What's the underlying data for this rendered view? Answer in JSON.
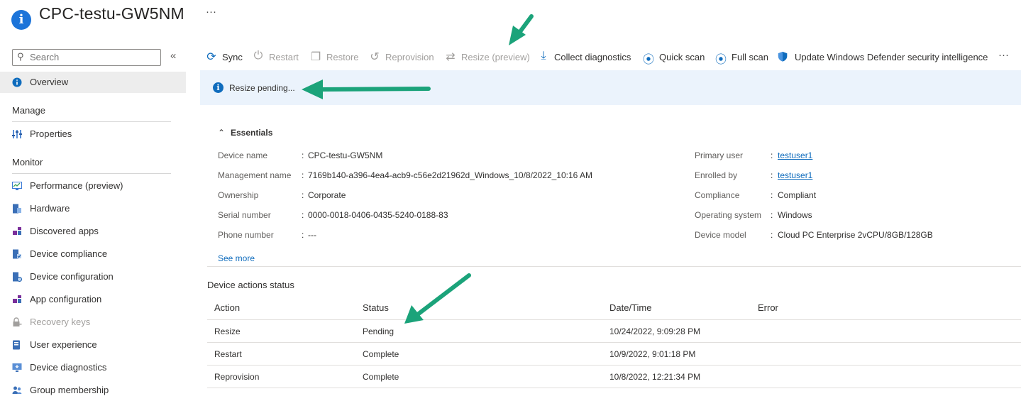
{
  "header": {
    "title": "CPC-testu-GW5NM",
    "more_label": "···"
  },
  "sidebar": {
    "search_placeholder": "Search",
    "collapse_label": "«",
    "overview": "Overview",
    "sections": [
      {
        "title": "Manage",
        "items": [
          {
            "label": "Properties",
            "icon": "properties-icon"
          }
        ]
      },
      {
        "title": "Monitor",
        "items": [
          {
            "label": "Performance (preview)",
            "icon": "performance-icon"
          },
          {
            "label": "Hardware",
            "icon": "hardware-icon"
          },
          {
            "label": "Discovered apps",
            "icon": "apps-icon"
          },
          {
            "label": "Device compliance",
            "icon": "compliance-icon"
          },
          {
            "label": "Device configuration",
            "icon": "configuration-icon"
          },
          {
            "label": "App configuration",
            "icon": "app-config-icon"
          },
          {
            "label": "Recovery keys",
            "icon": "lock-icon",
            "disabled": true
          },
          {
            "label": "User experience",
            "icon": "user-experience-icon"
          },
          {
            "label": "Device diagnostics",
            "icon": "diagnostics-icon"
          },
          {
            "label": "Group membership",
            "icon": "group-icon"
          }
        ]
      }
    ]
  },
  "toolbar": {
    "items": [
      {
        "label": "Sync",
        "icon": "sync-icon",
        "enabled": true
      },
      {
        "label": "Restart",
        "icon": "power-icon",
        "enabled": false
      },
      {
        "label": "Restore",
        "icon": "restore-icon",
        "enabled": false
      },
      {
        "label": "Reprovision",
        "icon": "reprovision-icon",
        "enabled": false
      },
      {
        "label": "Resize (preview)",
        "icon": "resize-icon",
        "enabled": false
      },
      {
        "label": "Collect diagnostics",
        "icon": "download-icon",
        "enabled": true
      },
      {
        "label": "Quick scan",
        "icon": "scan-icon",
        "enabled": true
      },
      {
        "label": "Full scan",
        "icon": "scan-icon",
        "enabled": true
      },
      {
        "label": "Update Windows Defender security intelligence",
        "icon": "shield-icon",
        "enabled": true
      }
    ],
    "more_label": "···"
  },
  "banner": {
    "message": "Resize pending..."
  },
  "essentials": {
    "title": "Essentials",
    "toggle_label": "^",
    "left": [
      {
        "key": "Device name",
        "value": "CPC-testu-GW5NM"
      },
      {
        "key": "Management name",
        "value": "7169b140-a396-4ea4-acb9-c56e2d21962d_Windows_10/8/2022_10:16 AM"
      },
      {
        "key": "Ownership",
        "value": "Corporate"
      },
      {
        "key": "Serial number",
        "value": "0000-0018-0406-0435-5240-0188-83"
      },
      {
        "key": "Phone number",
        "value": "---"
      }
    ],
    "right": [
      {
        "key": "Primary user",
        "value": "testuser1",
        "link": true
      },
      {
        "key": "Enrolled by",
        "value": "testuser1",
        "link": true
      },
      {
        "key": "Compliance",
        "value": "Compliant"
      },
      {
        "key": "Operating system",
        "value": "Windows"
      },
      {
        "key": "Device model",
        "value": "Cloud PC Enterprise 2vCPU/8GB/128GB"
      }
    ],
    "see_more": "See more"
  },
  "actions_status": {
    "title": "Device actions status",
    "columns": [
      "Action",
      "Status",
      "Date/Time",
      "Error"
    ],
    "rows": [
      {
        "action": "Resize",
        "status": "Pending",
        "datetime": "10/24/2022, 9:09:28 PM",
        "error": ""
      },
      {
        "action": "Restart",
        "status": "Complete",
        "datetime": "10/9/2022, 9:01:18 PM",
        "error": ""
      },
      {
        "action": "Reprovision",
        "status": "Complete",
        "datetime": "10/8/2022, 12:21:34 PM",
        "error": ""
      }
    ]
  },
  "colors": {
    "accent": "#0f6cbd",
    "banner_bg": "#ebf3fc",
    "arrow": "#1ba37a",
    "nav_active_bg": "#ededed"
  }
}
